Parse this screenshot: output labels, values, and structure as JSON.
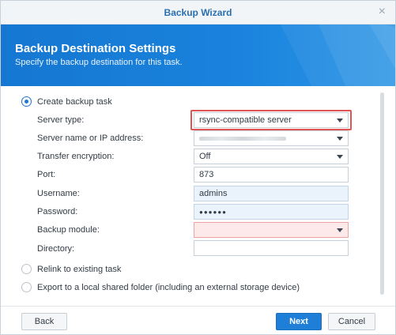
{
  "window": {
    "title": "Backup Wizard",
    "close_glyph": "×"
  },
  "banner": {
    "title": "Backup Destination Settings",
    "subtitle": "Specify the backup destination for this task."
  },
  "options": {
    "create": "Create backup task",
    "relink": "Relink to existing task",
    "export": "Export to a local shared folder (including an external storage device)"
  },
  "form": {
    "server_type": {
      "label": "Server type:",
      "value": "rsync-compatible server"
    },
    "server_name": {
      "label": "Server name or IP address:",
      "value": ""
    },
    "encryption": {
      "label": "Transfer encryption:",
      "value": "Off"
    },
    "port": {
      "label": "Port:",
      "value": "873"
    },
    "username": {
      "label": "Username:",
      "value": "admins"
    },
    "password": {
      "label": "Password:",
      "value": "●●●●●●"
    },
    "module": {
      "label": "Backup module:",
      "value": ""
    },
    "directory": {
      "label": "Directory:",
      "value": ""
    }
  },
  "buttons": {
    "back": "Back",
    "next": "Next",
    "cancel": "Cancel"
  },
  "colors": {
    "accent": "#1f7fd8",
    "highlight": "#e05454",
    "banner": "#1577d1"
  }
}
